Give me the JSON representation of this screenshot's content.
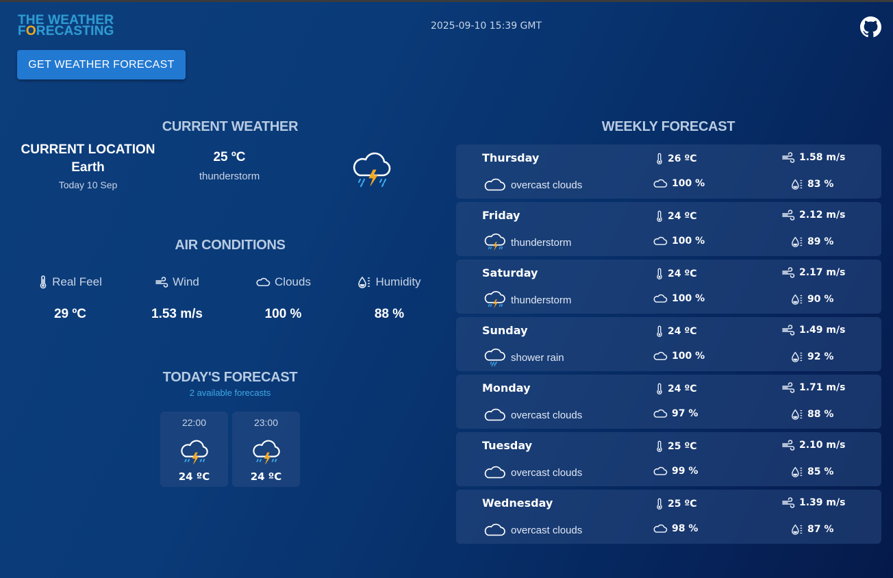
{
  "header": {
    "logo_line1": "THE WEATHER",
    "logo_line2_prefix": "F",
    "logo_line2_o": "O",
    "logo_line2_suffix": "RECASTING",
    "datetime": "2025-09-10 15:39 GMT",
    "get_forecast_label": "GET WEATHER FORECAST"
  },
  "current": {
    "section_title": "CURRENT WEATHER",
    "location_heading": "CURRENT LOCATION",
    "location_name": "Earth",
    "date": "Today 10 Sep",
    "temperature": "25 ºC",
    "description": "thunderstorm",
    "icon": "thunderstorm-icon"
  },
  "air": {
    "section_title": "AIR CONDITIONS",
    "items": [
      {
        "label": "Real Feel",
        "value": "29 ºC",
        "icon": "thermometer-icon"
      },
      {
        "label": "Wind",
        "value": "1.53 m/s",
        "icon": "wind-icon"
      },
      {
        "label": "Clouds",
        "value": "100 %",
        "icon": "cloud-icon"
      },
      {
        "label": "Humidity",
        "value": "88 %",
        "icon": "humidity-icon"
      }
    ]
  },
  "today": {
    "section_title": "TODAY'S FORECAST",
    "subtitle": "2 available forecasts",
    "hours": [
      {
        "time": "22:00",
        "temp": "24 ºC",
        "icon": "thunderstorm-icon"
      },
      {
        "time": "23:00",
        "temp": "24 ºC",
        "icon": "thunderstorm-icon"
      }
    ]
  },
  "weekly": {
    "section_title": "WEEKLY FORECAST",
    "days": [
      {
        "day": "Thursday",
        "desc": "overcast clouds",
        "icon": "overcast-cloud-icon",
        "temp": "26 ºC",
        "wind": "1.58 m/s",
        "clouds": "100 %",
        "humidity": "83 %"
      },
      {
        "day": "Friday",
        "desc": "thunderstorm",
        "icon": "thunderstorm-icon",
        "temp": "24 ºC",
        "wind": "2.12 m/s",
        "clouds": "100 %",
        "humidity": "89 %"
      },
      {
        "day": "Saturday",
        "desc": "thunderstorm",
        "icon": "thunderstorm-icon",
        "temp": "24 ºC",
        "wind": "2.17 m/s",
        "clouds": "100 %",
        "humidity": "90 %"
      },
      {
        "day": "Sunday",
        "desc": "shower rain",
        "icon": "shower-rain-icon",
        "temp": "24 ºC",
        "wind": "1.49 m/s",
        "clouds": "100 %",
        "humidity": "92 %"
      },
      {
        "day": "Monday",
        "desc": "overcast clouds",
        "icon": "overcast-cloud-icon",
        "temp": "24 ºC",
        "wind": "1.71 m/s",
        "clouds": "97 %",
        "humidity": "88 %"
      },
      {
        "day": "Tuesday",
        "desc": "overcast clouds",
        "icon": "overcast-cloud-icon",
        "temp": "25 ºC",
        "wind": "2.10 m/s",
        "clouds": "99 %",
        "humidity": "85 %"
      },
      {
        "day": "Wednesday",
        "desc": "overcast clouds",
        "icon": "overcast-cloud-icon",
        "temp": "25 ºC",
        "wind": "1.39 m/s",
        "clouds": "98 %",
        "humidity": "87 %"
      }
    ]
  },
  "colors": {
    "accent": "#2279d2",
    "logo_blue": "#2e9ad2",
    "logo_orange": "#f0a818",
    "section_title": "#b8cbe2",
    "subtitle_link": "#3fa9e8"
  }
}
